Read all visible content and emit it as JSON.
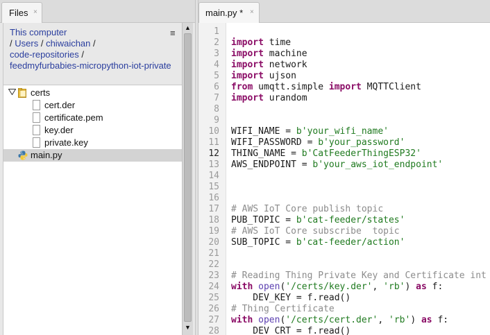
{
  "files_pane": {
    "tab_label": "Files",
    "tab_close": "×",
    "menu_icon": "≡",
    "breadcrumb": {
      "root": "This computer",
      "sep": "/",
      "parts": [
        "Users",
        "chiwaichan",
        "code-repositories",
        "feedmyfurbabies-micropython-iot-private"
      ]
    },
    "tree": {
      "folder": "certs",
      "files": [
        "cert.der",
        "certificate.pem",
        "key.der",
        "private.key"
      ],
      "main_file": "main.py"
    }
  },
  "editor": {
    "tab_label": "main.py *",
    "tab_close": "×",
    "current_line": 12,
    "line_count": 28
  },
  "icons": {
    "folder": "folder-icon",
    "file": "file-icon",
    "python_file": "python-file-icon",
    "expander": "triangle-down-icon",
    "menu": "menu-icon",
    "scroll_up": "scroll-up-icon",
    "scroll_down": "scroll-down-icon"
  },
  "colors": {
    "keyword": "#8a0b65",
    "string": "#1f7a1f",
    "comment": "#8c8c8c",
    "link": "#2a3e9e",
    "selection": "#d3d3d3"
  },
  "code_lines": [
    [],
    [
      [
        "kw",
        "import"
      ],
      [
        "t",
        " time"
      ]
    ],
    [
      [
        "kw",
        "import"
      ],
      [
        "t",
        " machine"
      ]
    ],
    [
      [
        "kw",
        "import"
      ],
      [
        "t",
        " network"
      ]
    ],
    [
      [
        "kw",
        "import"
      ],
      [
        "t",
        " ujson"
      ]
    ],
    [
      [
        "kw",
        "from"
      ],
      [
        "t",
        " umqtt.simple "
      ],
      [
        "kw",
        "import"
      ],
      [
        "t",
        " MQTTClient"
      ]
    ],
    [
      [
        "kw",
        "import"
      ],
      [
        "t",
        " urandom"
      ]
    ],
    [],
    [],
    [
      [
        "t",
        "WIFI_NAME = "
      ],
      [
        "str",
        "b'your_wifi_name'"
      ]
    ],
    [
      [
        "t",
        "WIFI_PASSWORD = "
      ],
      [
        "str",
        "b'your_password'"
      ]
    ],
    [
      [
        "t",
        "THING_NAME = "
      ],
      [
        "str",
        "b'CatFeederThingESP32'"
      ]
    ],
    [
      [
        "t",
        "AWS_ENDPOINT = "
      ],
      [
        "str",
        "b'your_aws_iot_endpoint'"
      ]
    ],
    [],
    [],
    [],
    [
      [
        "cm",
        "# AWS IoT Core publish topic"
      ]
    ],
    [
      [
        "t",
        "PUB_TOPIC = "
      ],
      [
        "str",
        "b'cat-feeder/states'"
      ]
    ],
    [
      [
        "cm",
        "# AWS IoT Core subscribe  topic"
      ]
    ],
    [
      [
        "t",
        "SUB_TOPIC = "
      ],
      [
        "str",
        "b'cat-feeder/action'"
      ]
    ],
    [],
    [],
    [
      [
        "cm",
        "# Reading Thing Private Key and Certificate int"
      ]
    ],
    [
      [
        "kw",
        "with"
      ],
      [
        "t",
        " "
      ],
      [
        "fn",
        "open"
      ],
      [
        "t",
        "("
      ],
      [
        "str",
        "'/certs/key.der'"
      ],
      [
        "t",
        ", "
      ],
      [
        "str",
        "'rb'"
      ],
      [
        "t",
        ") "
      ],
      [
        "kw",
        "as"
      ],
      [
        "t",
        " f:"
      ]
    ],
    [
      [
        "t",
        "    DEV_KEY = f.read()"
      ]
    ],
    [
      [
        "cm",
        "# Thing Certificate"
      ]
    ],
    [
      [
        "kw",
        "with"
      ],
      [
        "t",
        " "
      ],
      [
        "fn",
        "open"
      ],
      [
        "t",
        "("
      ],
      [
        "str",
        "'/certs/cert.der'"
      ],
      [
        "t",
        ", "
      ],
      [
        "str",
        "'rb'"
      ],
      [
        "t",
        ") "
      ],
      [
        "kw",
        "as"
      ],
      [
        "t",
        " f:"
      ]
    ],
    [
      [
        "t",
        "    DEV_CRT = f.read()"
      ]
    ]
  ]
}
